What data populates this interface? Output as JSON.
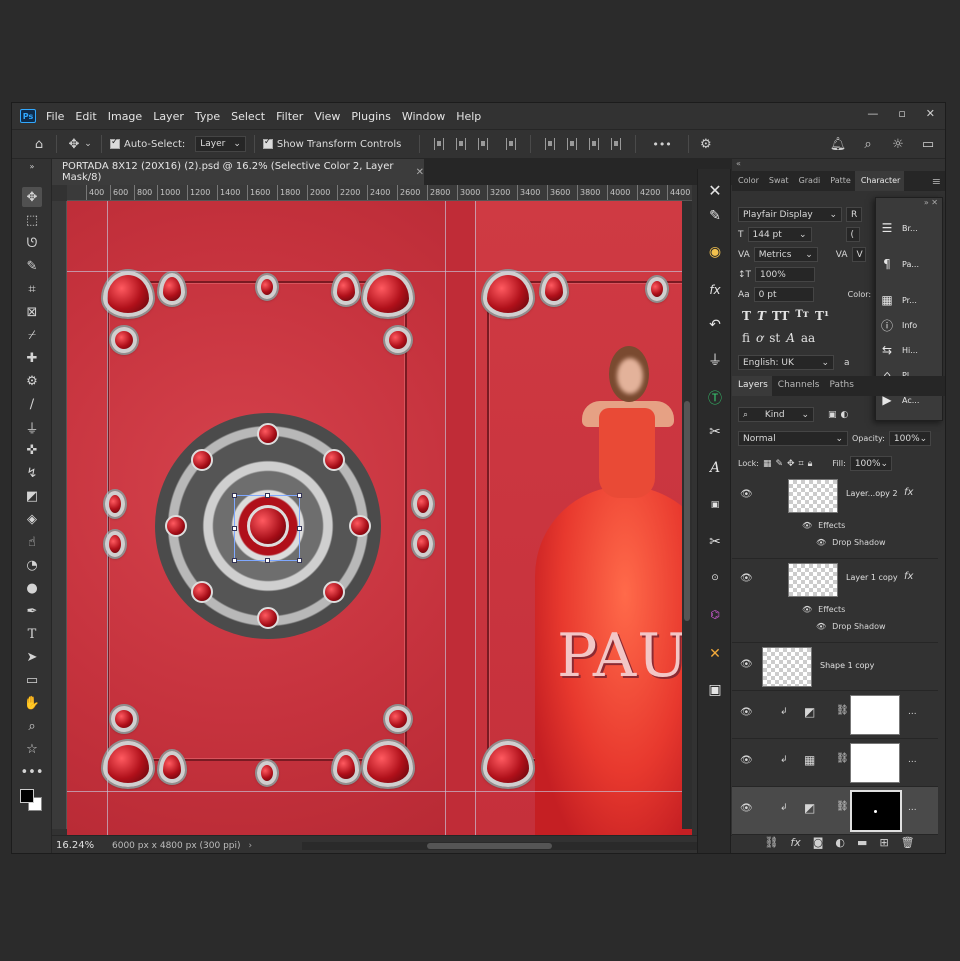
{
  "app": {
    "logo": "Ps"
  },
  "menu": [
    "File",
    "Edit",
    "Image",
    "Layer",
    "Type",
    "Select",
    "Filter",
    "View",
    "Plugins",
    "Window",
    "Help"
  ],
  "options": {
    "auto_select_label": "Auto-Select:",
    "auto_select_value": "Layer",
    "show_transform_label": "Show Transform Controls",
    "more": "•••"
  },
  "document": {
    "tab_title": "PORTADA 8X12 (20X16) (2).psd @ 16.2% (Selective Color 2, Layer Mask/8)",
    "zoom": "16.24%",
    "size_info": "6000 px x 4800 px (300 ppi)",
    "ruler_ticks": [
      "400",
      "600",
      "800",
      "1000",
      "1200",
      "1400",
      "1600",
      "1800",
      "2000",
      "2200",
      "2400",
      "2600",
      "2800",
      "3000",
      "3200",
      "3400",
      "3600",
      "3800",
      "4000",
      "4200",
      "4400"
    ],
    "cover_text": "PAU"
  },
  "panels": {
    "top_tabs": [
      "Color",
      "Swat",
      "Gradi",
      "Patte",
      "Character"
    ],
    "character": {
      "font": "Playfair Display",
      "style_short": "R",
      "size": "144 pt",
      "kerning": "Metrics",
      "leading_short": "(",
      "tracking_short": "V",
      "vscale": "100%",
      "baseline": "0 pt",
      "color_label": "Color:",
      "language": "English: UK",
      "aa": "a"
    },
    "flyout": [
      {
        "icon": "brush-settings-icon",
        "label": "Br..."
      },
      {
        "icon": "paragraph-icon",
        "label": "Pa..."
      },
      {
        "icon": "properties-icon",
        "label": "Pr..."
      },
      {
        "icon": "info-icon",
        "label": "Info"
      },
      {
        "icon": "history-icon",
        "label": "Hi..."
      },
      {
        "icon": "plugins-icon",
        "label": "Pl..."
      },
      {
        "icon": "actions-icon",
        "label": "Ac..."
      }
    ],
    "layers_tabs": [
      "Layers",
      "Channels",
      "Paths"
    ],
    "kind_label": "Kind",
    "blend_mode": "Normal",
    "opacity_label": "Opacity:",
    "opacity_value": "100%",
    "lock_label": "Lock:",
    "fill_label": "Fill:",
    "fill_value": "100%",
    "layers": [
      {
        "name": "Layer...opy 2",
        "fx": "fx",
        "effects": "Effects",
        "effect": "Drop Shadow"
      },
      {
        "name": "Layer 1 copy",
        "fx": "fx",
        "effects": "Effects",
        "effect": "Drop Shadow"
      },
      {
        "name": "Shape 1 copy"
      }
    ],
    "more_dots": "..."
  },
  "colors": {
    "app_bg": "#323232",
    "canvas_red": "#c8303a",
    "accent": "#31a8ff"
  }
}
